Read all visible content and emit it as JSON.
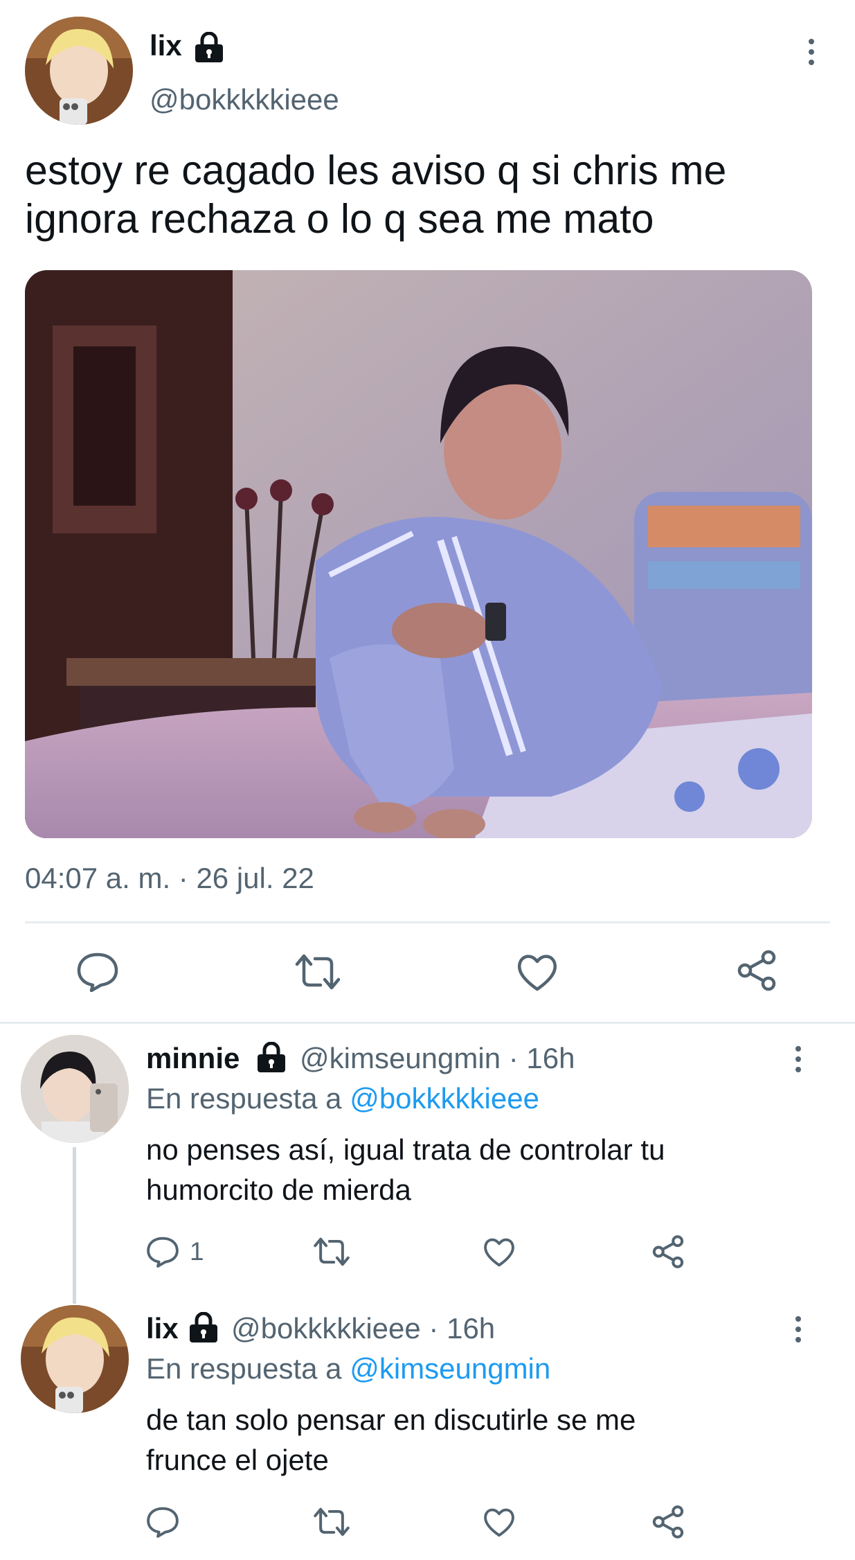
{
  "main_tweet": {
    "display_name": "lix",
    "handle": "@bokkkkkieee",
    "text_line1": "estoy re cagado les aviso q si chris me",
    "text_line2": "ignora rechaza o lo q sea me mato",
    "timestamp": "04:07 a. m. · 26 jul. 22"
  },
  "replies": [
    {
      "display_name": "minnie",
      "handle_time": "@kimseungmin · 16h",
      "reply_prefix": "En respuesta a",
      "reply_to": "@bokkkkkieee",
      "text_line1": "no penses así, igual trata de controlar tu",
      "text_line2": "humorcito de mierda",
      "reply_count": "1"
    },
    {
      "display_name": "lix",
      "handle_time": "@bokkkkkieee · 16h",
      "reply_prefix": "En respuesta a",
      "reply_to": "@kimseungmin",
      "text_line1": "de tan solo pensar en discutirle se me",
      "text_line2": "frunce el ojete",
      "reply_count": ""
    }
  ],
  "colors": {
    "text": "#0f1419",
    "secondary": "#536471",
    "link": "#1d9bf0",
    "divider": "#eff3f4"
  },
  "icons": [
    "lock-icon",
    "more-icon",
    "reply-icon",
    "retweet-icon",
    "like-icon",
    "share-icon"
  ]
}
